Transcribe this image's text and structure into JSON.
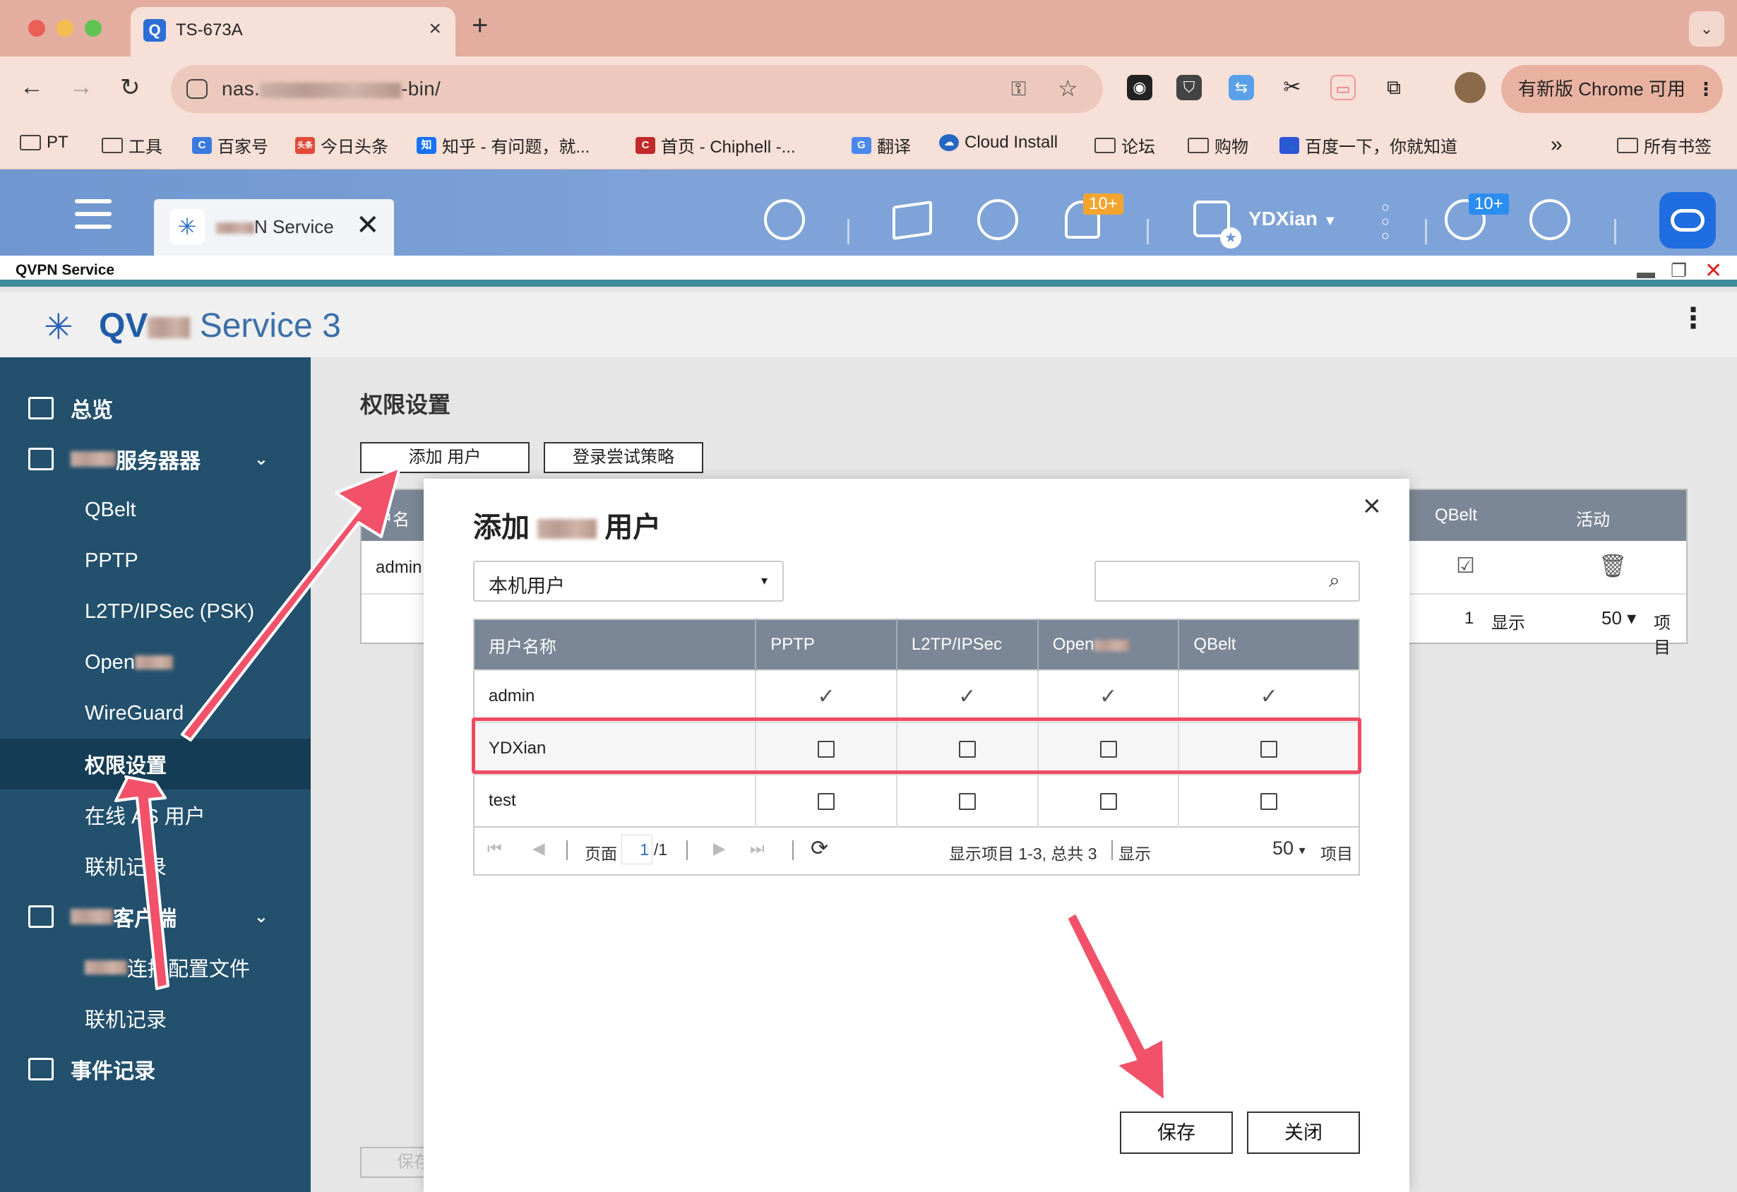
{
  "browser": {
    "tab_title": "TS-673A",
    "url": "nas.",
    "url_suffix": "-bin/",
    "update_label": "有新版 Chrome 可用",
    "bookmarks": [
      "PT",
      "工具",
      "百家号",
      "今日头条",
      "知乎 - 有问题，就...",
      "首页 - Chiphell -...",
      "翻译",
      "Cloud Install",
      "论坛",
      "购物",
      "百度一下，你就知道"
    ],
    "all_bookmarks": "所有书签",
    "more_bookmarks": "»"
  },
  "qts": {
    "tab_title": "N Service",
    "notification_badge": "10+",
    "info_badge": "10+",
    "user_name": "YDXian"
  },
  "window": {
    "title": "QVPN Service",
    "app_title_prefix": "QV",
    "app_title_suffix": " Service 3"
  },
  "sidebar": {
    "overview": "总览",
    "server_group": "服务器器",
    "server_items": [
      "QBelt",
      "PPTP",
      "L2TP/IPSec (PSK)",
      "Open",
      "WireGuard",
      "权限设置",
      "在线 AS 用户",
      "联机记录"
    ],
    "client_group": "客户端",
    "client_items": [
      "连接配置文件",
      "联机记录"
    ],
    "event_log": "事件记录"
  },
  "main": {
    "title": "权限设置",
    "add_user_button": "添加 用户",
    "login_policy_button": "登录尝试策略",
    "bg_headers": [
      "户名",
      "QBelt",
      "活动"
    ],
    "bg_row": "admin",
    "bg_pager_suffix": "1",
    "bg_show": "显示",
    "bg_per_page": "50",
    "bg_items": "项目",
    "bg_save": "保存"
  },
  "dialog": {
    "title_prefix": "添加",
    "title_suffix": "用户",
    "user_type": "本机用户",
    "search_placeholder": "",
    "columns": [
      "用户名称",
      "PPTP",
      "L2TP/IPSec",
      "Open",
      "QBelt"
    ],
    "rows": [
      {
        "name": "admin",
        "pptp": "✓",
        "l2tp": "✓",
        "openvpn": "✓",
        "qbelt": "✓",
        "checked": true
      },
      {
        "name": "YDXian",
        "checked": false
      },
      {
        "name": "test",
        "checked": false
      }
    ],
    "pager": {
      "page_label": "页面",
      "page_value": "1",
      "page_total": "/1",
      "summary": "显示项目 1-3, 总共 3",
      "show_label": "显示",
      "per_page": "50",
      "items_label": "项目"
    },
    "save_button": "保存",
    "close_button": "关闭"
  },
  "colors": {
    "sidebar": "#22506d",
    "highlight": "#ef4a63",
    "header_row": "#7b8796",
    "arrow": "#f2516a"
  }
}
